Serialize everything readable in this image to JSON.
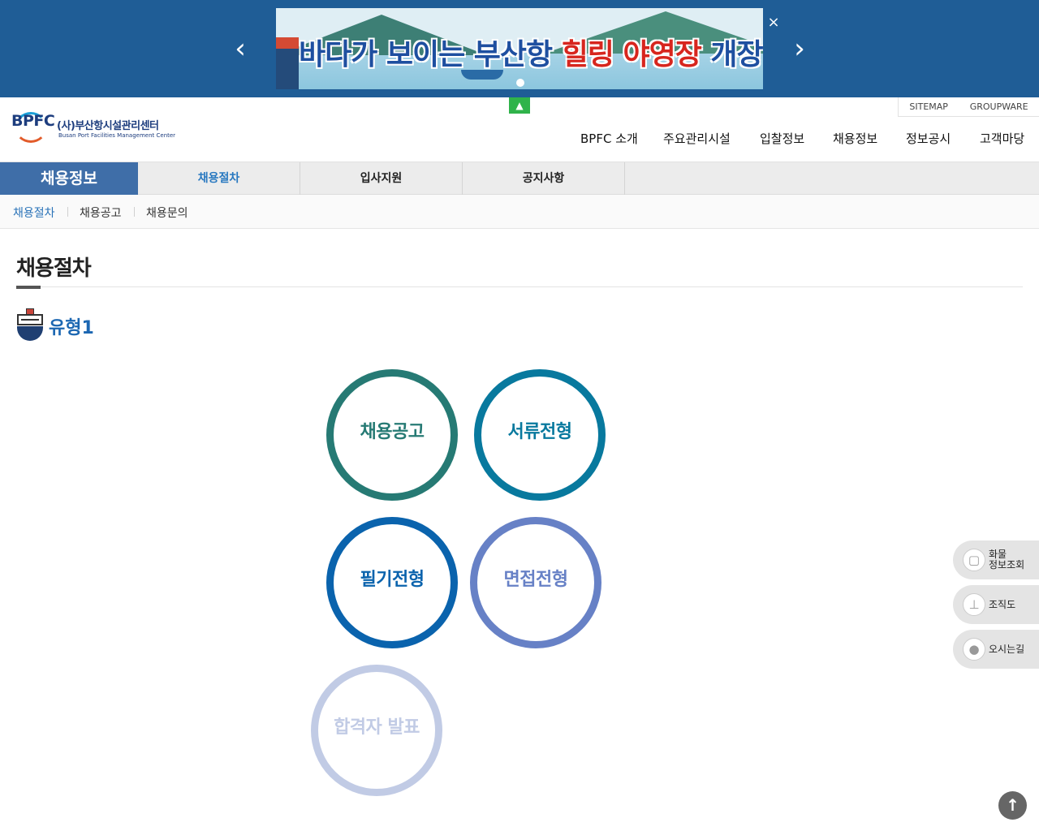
{
  "banner": {
    "headline_part1": "바다가 보이는 부산항 ",
    "headline_highlight": "힐링 야영장",
    "headline_part2": " 개장",
    "prev_glyph": "‹",
    "next_glyph": "›",
    "close_glyph": "×"
  },
  "header": {
    "logo_mark": "BPFC",
    "logo_name": "(사)부산항시설관리센터",
    "logo_eng": "Busan Port Facilities Management Center",
    "up_glyph": "▲",
    "util": {
      "sitemap": "SITEMAP",
      "groupware": "GROUPWARE"
    },
    "gnb": [
      "BPFC 소개",
      "주요관리시설",
      "입찰정보",
      "채용정보",
      "정보공시",
      "고객마당"
    ]
  },
  "subnav": {
    "section_title": "채용정보",
    "tabs": [
      "채용절차",
      "입사지원",
      "공지사항"
    ]
  },
  "thirdnav": {
    "items": [
      "채용절차",
      "채용공고",
      "채용문의"
    ]
  },
  "content": {
    "page_title": "채용절차",
    "type_label": "유형1",
    "steps": [
      {
        "label": "채용공고",
        "color": "#267a74"
      },
      {
        "label": "서류전형",
        "color": "#08799e"
      },
      {
        "label": "필기전형",
        "color": "#0a63ad"
      },
      {
        "label": "면접전형",
        "color": "#6781c6"
      },
      {
        "label": "합격자 발표",
        "color": "#c1cbe5"
      }
    ]
  },
  "quick": {
    "cargo_line1": "화물",
    "cargo_line2": "정보조회",
    "org": "조직도",
    "map": "오시는길"
  },
  "totop_glyph": "↑",
  "colors": {
    "banner_bg": "#1f5d96",
    "section_bg": "#3f6ea8",
    "accent_blue": "#2a73b8",
    "up_tab_green": "#2fb34a"
  }
}
